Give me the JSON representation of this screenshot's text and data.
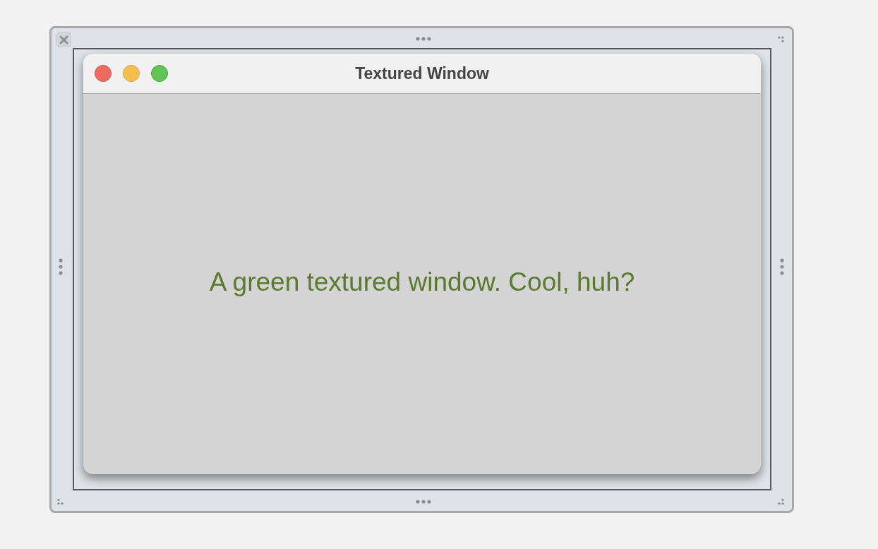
{
  "window": {
    "title": "Textured Window"
  },
  "content": {
    "label": "A green textured window. Cool, huh?"
  }
}
